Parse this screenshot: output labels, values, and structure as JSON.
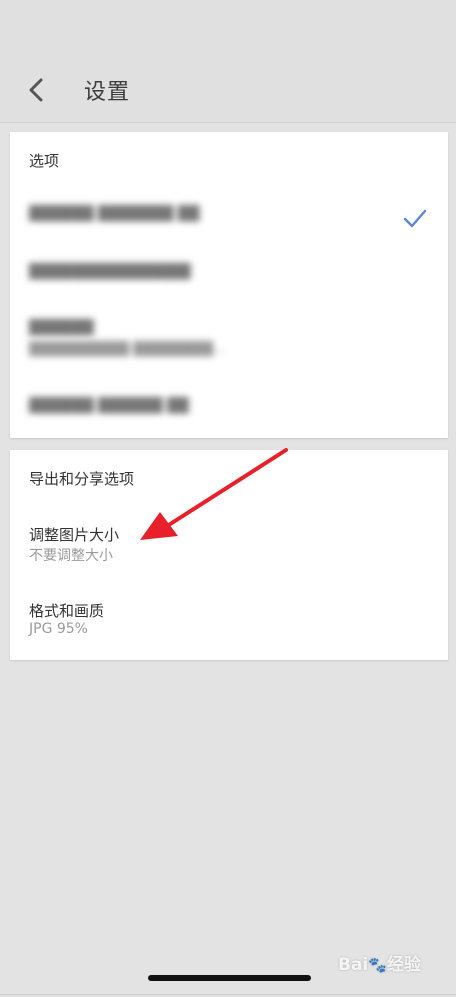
{
  "header": {
    "title": "设置"
  },
  "options_card": {
    "section_title": "选项",
    "items": [
      {
        "label": "██████ ███████ ██",
        "checked": true
      },
      {
        "label": "███████████████"
      },
      {
        "label": "██████",
        "sublabel": "██████████ ████████..."
      },
      {
        "label": "██████ ██████ ██"
      }
    ]
  },
  "export_card": {
    "section_title": "导出和分享选项",
    "items": [
      {
        "label": "调整图片大小",
        "sublabel": "不要调整大小"
      },
      {
        "label": "格式和画质",
        "sublabel": "JPG 95%"
      }
    ]
  },
  "watermark": {
    "text": "Bai",
    "paw": "🐾",
    "suffix": "经验"
  },
  "colors": {
    "accent": "#5b87d4",
    "arrow": "#e8202a",
    "background": "#e3e3e3"
  }
}
